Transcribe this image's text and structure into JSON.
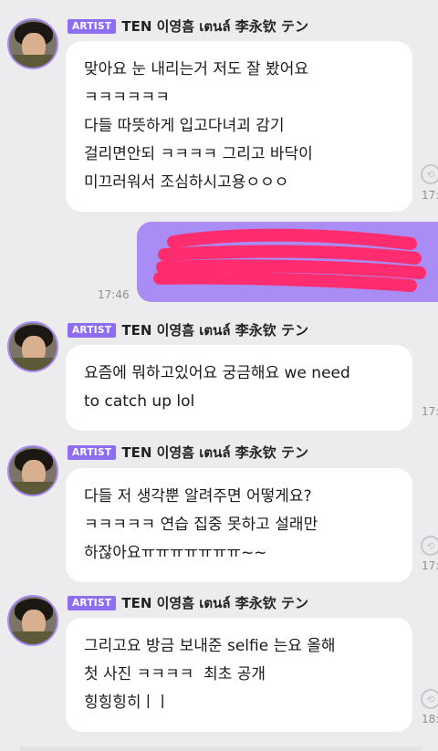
{
  "badge_label": "ARTIST",
  "artist_name": "TEN 이영흠 เตนล์ 李永钦 テン",
  "messages": [
    {
      "text": "맞아요 눈 내리는거 저도 잘 봤어요\nㅋㅋㅋㅋㅋㅋ\n다들 따뜻하게 입고다녀괴 감기\n걸리면안되 ㅋㅋㅋㅋ 그리고 바닥이\n미끄러워서 조심하시고용ㅇㅇㅇ",
      "time": "17:"
    },
    {
      "text": "요즘에 뭐하고있어요 궁금해요 we need\nto catch up lol",
      "time": "17:"
    },
    {
      "text": "다들 저 생각뿐 알려주면 어떻게요?\nㅋㅋㅋㅋㅋ 연습 집중 못하고 설래만\n하잖아요ㅠㅠㅠㅠㅠㅠㅠ~~",
      "time": "17:"
    },
    {
      "text": "그리고요 방금 보내준 selfie 는요 올해\n첫 사진 ㅋㅋㅋㅋ  최초 공개\n힝힝힝히ㅣㅣ",
      "time": "18:"
    }
  ],
  "my_message": {
    "time": "17:46"
  },
  "colors": {
    "accent": "#8d6df0",
    "my_bubble": "#a98cf4",
    "scribble": "#ff2d6f",
    "background": "#ececef"
  }
}
